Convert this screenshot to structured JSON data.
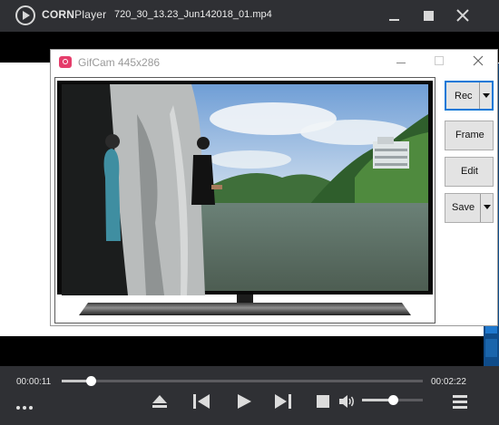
{
  "player": {
    "brand_bold": "CORN",
    "brand_light": "Player",
    "filename": "720_30_13.23_Jun142018_01.mp4",
    "window_controls": [
      "minimize-icon",
      "maximize-icon",
      "close-icon"
    ]
  },
  "gifcam": {
    "title": "GifCam 445x286",
    "buttons": {
      "rec": "Rec",
      "frame": "Frame",
      "edit": "Edit",
      "save": "Save"
    }
  },
  "controls": {
    "time_current": "00:00:11",
    "time_total": "00:02:22",
    "seek_fraction": 0.08,
    "volume_fraction": 0.5,
    "icons": [
      "more-icon",
      "eject-icon",
      "previous-icon",
      "play-icon",
      "next-icon",
      "stop-icon",
      "volume-icon",
      "menu-icon"
    ]
  },
  "colors": {
    "player_bar": "#2f3034",
    "rec_focus": "#0a78d7",
    "gifcam_logo": "#e53d6b"
  }
}
